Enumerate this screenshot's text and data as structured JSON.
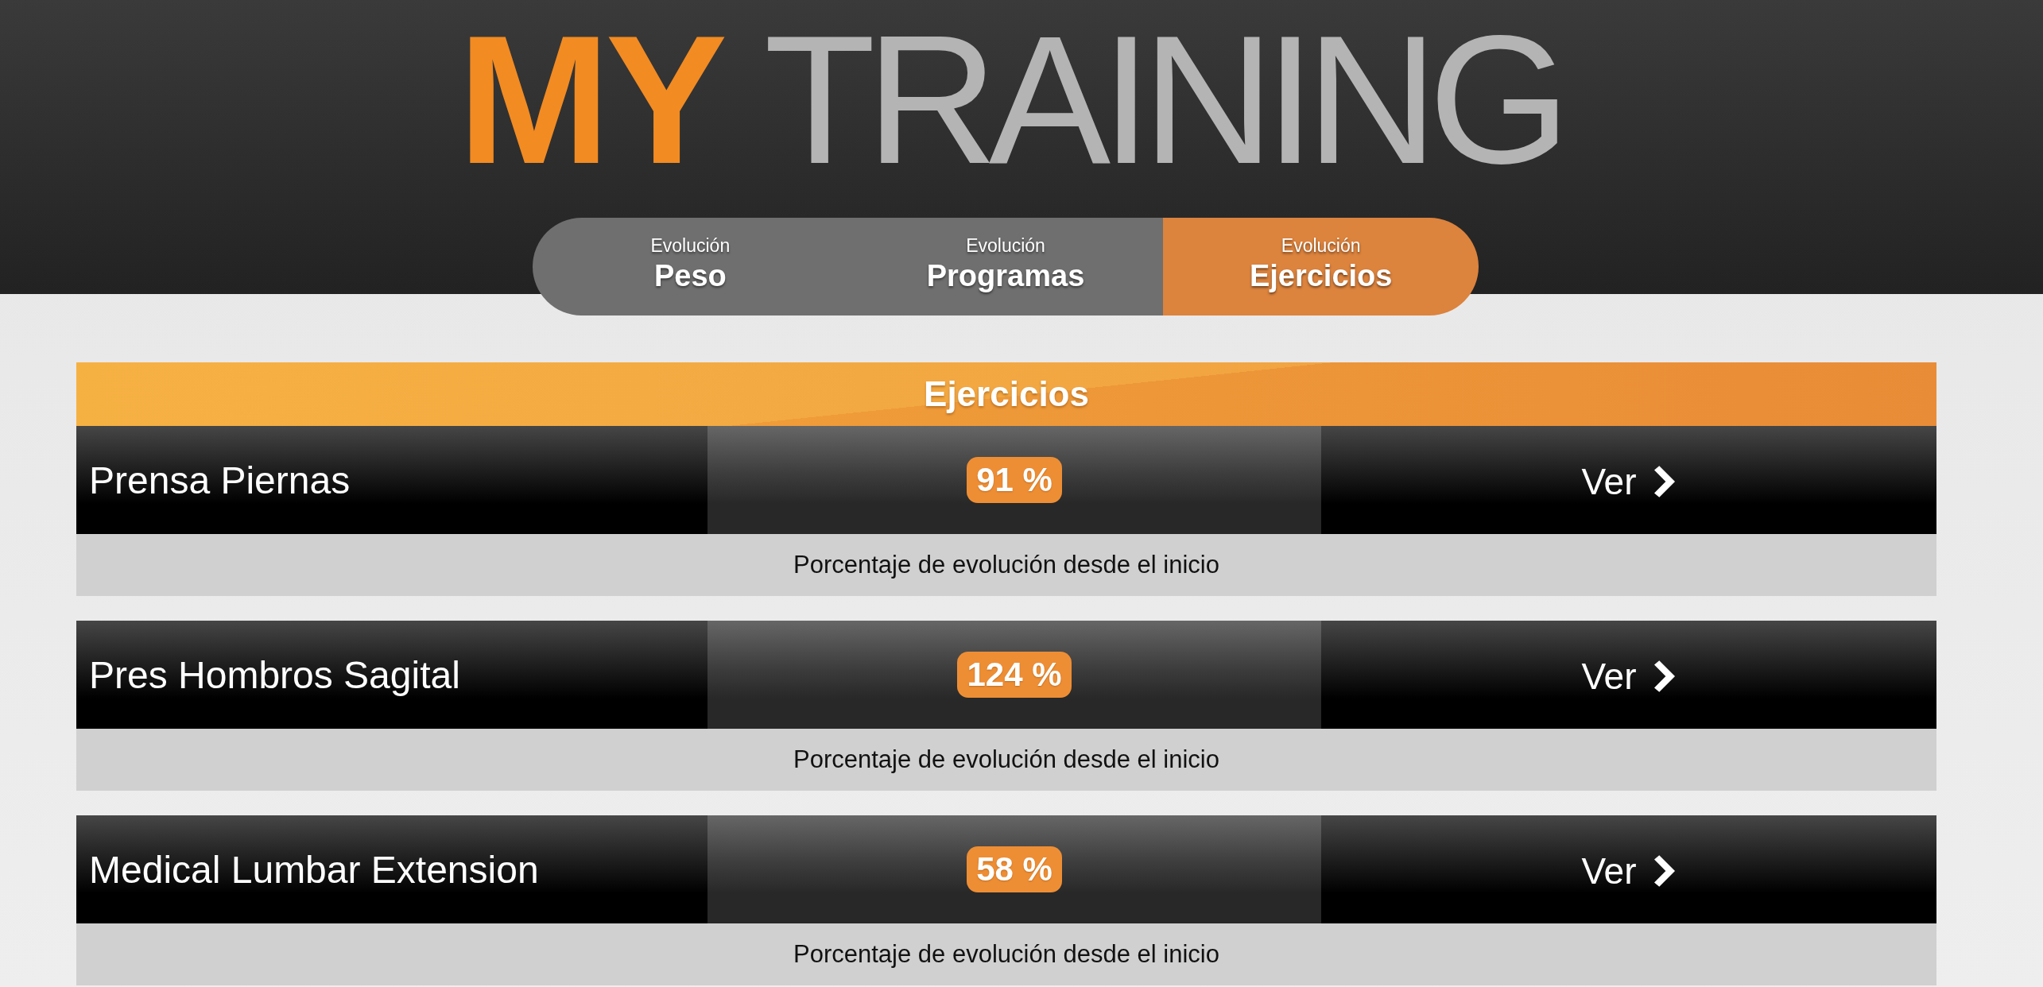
{
  "logo": {
    "accent": "MY",
    "main": "TRAINING"
  },
  "tabs": [
    {
      "caption": "Evolución",
      "label": "Peso",
      "selected": false
    },
    {
      "caption": "Evolución",
      "label": "Programas",
      "selected": false
    },
    {
      "caption": "Evolución",
      "label": "Ejercicios",
      "selected": true
    }
  ],
  "section": {
    "title": "Ejercicios"
  },
  "exercises": [
    {
      "name": "Prensa Piernas",
      "percent": "91 %",
      "action": "Ver",
      "note": "Porcentaje de evolución desde el inicio"
    },
    {
      "name": "Pres Hombros Sagital",
      "percent": "124 %",
      "action": "Ver",
      "note": "Porcentaje de evolución desde el inicio"
    },
    {
      "name": "Medical Lumbar Extension",
      "percent": "58 %",
      "action": "Ver",
      "note": "Porcentaje de evolución desde el inicio"
    }
  ]
}
